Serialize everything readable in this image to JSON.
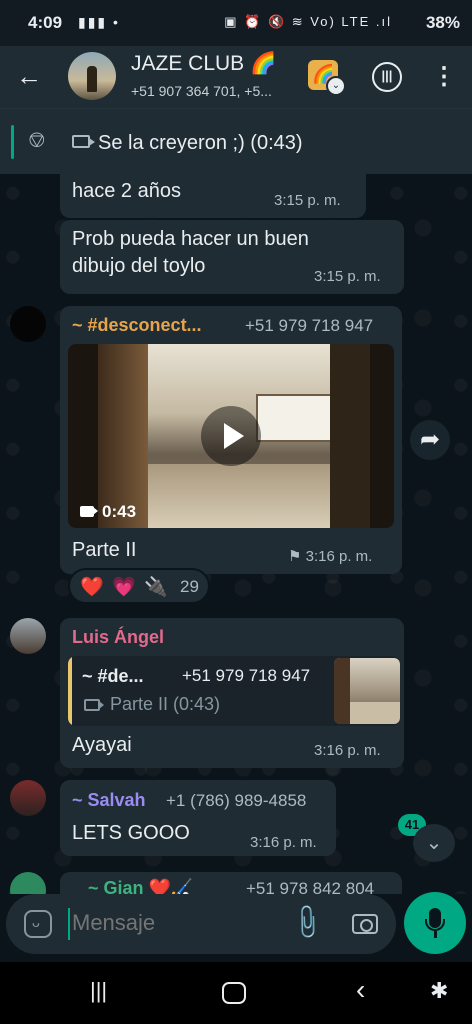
{
  "status": {
    "time": "4:09",
    "left_icons": "▮▮▮ •",
    "right_icons": "▣ ⏰ 🔇 ≋ Vo) LTE .ıl",
    "battery": "38%"
  },
  "header": {
    "title": "JAZE CLUB 🌈",
    "subtitle": "+51 907 364 701, +5...",
    "video_call_icon": "🌈"
  },
  "pinned": {
    "text": "Se la creyeron ;) (0:43)"
  },
  "messages": [
    {
      "text": "hace 2 años",
      "time": "3:15 p. m."
    },
    {
      "text_line1": "Prob pueda hacer un buen",
      "text_line2": "dibujo del toylo",
      "time": "3:15 p. m."
    },
    {
      "sender": "~ #desconect...",
      "phone": "+51 979 718 947",
      "video_duration": "0:43",
      "caption": "Parte II",
      "time": "3:16 p. m.",
      "reactions": [
        "❤️",
        "💗",
        "🔌"
      ],
      "reaction_count": "29"
    },
    {
      "sender": "Luis Ángel",
      "quote": {
        "name": "~ #de...",
        "phone": "+51 979 718 947",
        "text": "Parte II (0:43)"
      },
      "text": "Ayayai",
      "time": "3:16 p. m."
    },
    {
      "sender": "~ Salvah",
      "phone": "+1 (786) 989-4858",
      "text": "LETS GOOO",
      "time": "3:16 p. m."
    },
    {
      "sender": "~ Gian ❤️🏑",
      "phone": "+51 978 842 804"
    }
  ],
  "unread_count": "41",
  "composer": {
    "placeholder": "Mensaje"
  },
  "colors": {
    "accent": "#00a884",
    "bubble": "#1f2c34",
    "background": "#0b141a",
    "sender_pink": "#e26a8d",
    "sender_orange": "#e8a44a",
    "sender_purple": "#9a8cf0",
    "sender_green": "#3fb37f"
  }
}
